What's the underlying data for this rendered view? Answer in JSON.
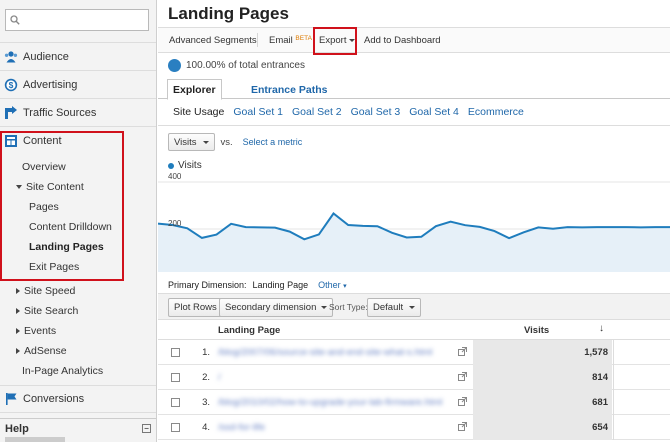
{
  "sidebar": {
    "search": {
      "value": "",
      "placeholder": ""
    },
    "sections": {
      "audience": "Audience",
      "advertising": "Advertising",
      "traffic_sources": "Traffic Sources",
      "content": "Content",
      "conversions": "Conversions"
    },
    "content_items": {
      "overview": "Overview",
      "site_content": "Site Content",
      "pages": "Pages",
      "content_drilldown": "Content Drilldown",
      "landing_pages": "Landing Pages",
      "exit_pages": "Exit Pages",
      "site_speed": "Site Speed",
      "site_search": "Site Search",
      "events": "Events",
      "adsense": "AdSense",
      "in_page_analytics": "In-Page Analytics"
    },
    "help": "Help"
  },
  "main": {
    "title": "Landing Pages",
    "toolbar": {
      "advanced_segments": "Advanced Segments",
      "email": "Email",
      "beta": "BETA",
      "export": "Export",
      "add_to_dashboard": "Add to Dashboard"
    },
    "percent_text": "100.00% of total entrances",
    "tabs": {
      "explorer": "Explorer",
      "entrance_paths": "Entrance Paths"
    },
    "subnav": [
      "Site Usage",
      "Goal Set 1",
      "Goal Set 2",
      "Goal Set 3",
      "Goal Set 4",
      "Ecommerce"
    ],
    "metric": {
      "selected": "Visits",
      "vs": "vs.",
      "select_metric": "Select a metric"
    },
    "legend": "Visits",
    "dimension": {
      "label": "Primary Dimension:",
      "value": "Landing Page",
      "other": "Other"
    },
    "controls": {
      "plot_rows": "Plot Rows",
      "secondary_dimension": "Secondary dimension",
      "sort_type_label": "Sort Type:",
      "sort_type_value": "Default"
    },
    "table": {
      "col_landing_page": "Landing Page",
      "col_visits": "Visits",
      "sort_arrow": "↓",
      "rows": [
        {
          "num": "1.",
          "page": "/blog/2007/06/source-site-and-end-site-what-s.html",
          "visits": "1,578"
        },
        {
          "num": "2.",
          "page": "/",
          "visits": "814"
        },
        {
          "num": "3.",
          "page": "/blog/2010/02/how-to-upgrade-your-lab-firmware.html",
          "visits": "681"
        },
        {
          "num": "4.",
          "page": "/ssd-for-life",
          "visits": "654"
        }
      ]
    }
  },
  "colors": {
    "accent": "#1f7dbd",
    "highlight_border": "#d0111b",
    "link": "#1f67a9"
  },
  "chart_data": {
    "type": "area",
    "series": [
      {
        "name": "Visits",
        "values": [
          223,
          217,
          203,
          162,
          176,
          222,
          208,
          207,
          206,
          189,
          156,
          177,
          266,
          217,
          213,
          212,
          184,
          164,
          167,
          212,
          231,
          216,
          209,
          191,
          161,
          186,
          207,
          201,
          208,
          207,
          208,
          208,
          208,
          207,
          208,
          208
        ]
      }
    ],
    "ylim": [
      0,
      400
    ],
    "y_ticks": [
      "400",
      "200"
    ],
    "grid": true,
    "legend": "top-left"
  }
}
